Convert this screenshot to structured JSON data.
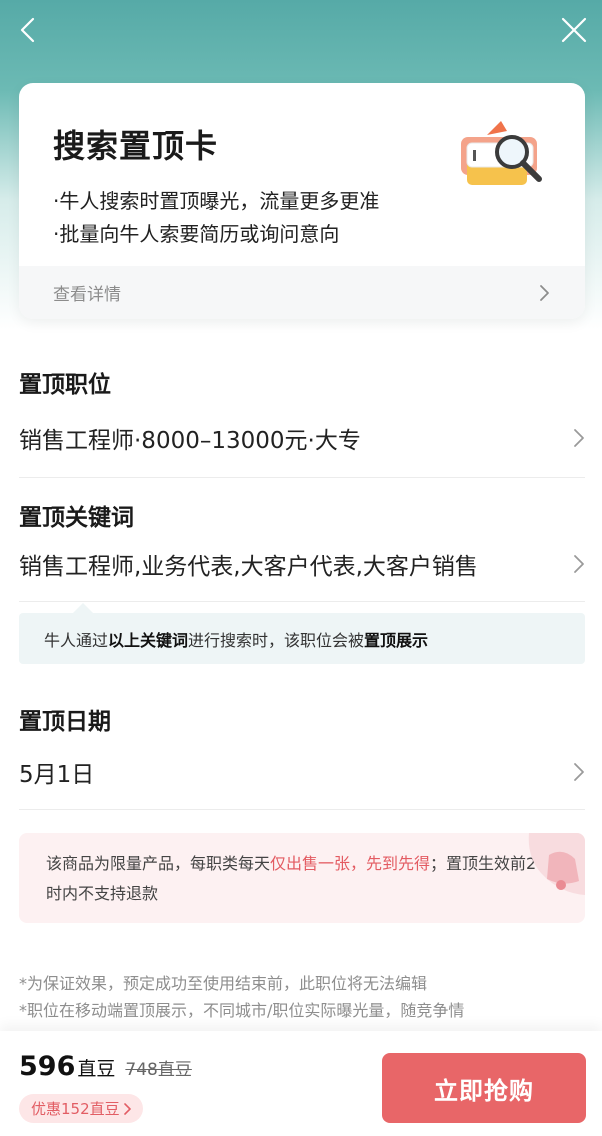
{
  "card": {
    "title": "搜索置顶卡",
    "bullets": [
      "·牛人搜索时置顶曝光，流量更多更准",
      "·批量向牛人索要简历或询问意向"
    ],
    "details_link": "查看详情"
  },
  "position": {
    "title": "置顶职位",
    "value": "销售工程师·8000–13000元·大专"
  },
  "keywords": {
    "title": "置顶关键词",
    "value": "销售工程师,业务代表,大客户代表,大客户销售"
  },
  "tip": {
    "part1": "牛人通过",
    "bold1": "以上关键词",
    "part2": "进行搜索时，该职位会被",
    "bold2": "置顶展示"
  },
  "date": {
    "title": "置顶日期",
    "value": "5月1日"
  },
  "warning": {
    "part1": "该商品为限量产品，每职类每天",
    "highlight": "仅出售一张，先到先得",
    "part2": "；置顶生效前24小时内不支持退款"
  },
  "notes": [
    "*为保证效果，预定成功至使用结束前，此职位将无法编辑",
    "*职位在移动端置顶展示，不同城市/职位实际曝光量，随竞争情"
  ],
  "bottom": {
    "price": "596",
    "unit": "直豆",
    "original": "748直豆",
    "discount": "优惠152直豆",
    "buy_label": "立即抢购"
  },
  "colors": {
    "header_teal": "#56aaa7",
    "accent_red": "#e86668",
    "tip_bg": "#eef5f6",
    "warn_bg": "#fdf1f2"
  }
}
